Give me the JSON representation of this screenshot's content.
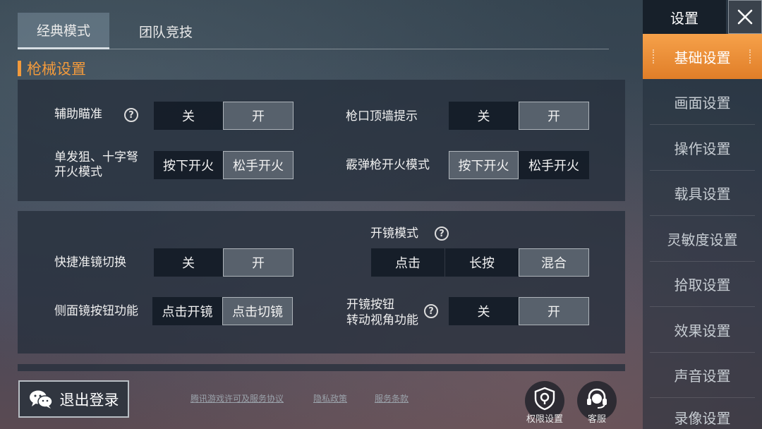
{
  "tabs": [
    {
      "label": "经典模式",
      "active": true
    },
    {
      "label": "团队竞技",
      "active": false
    }
  ],
  "section_title": "枪械设置",
  "panel1": {
    "rows": [
      {
        "label": "辅助瞄准",
        "options": [
          "关",
          "开"
        ],
        "selected": 1,
        "help": true
      },
      {
        "label": "枪口顶墙提示",
        "options": [
          "关",
          "开"
        ],
        "selected": 1
      },
      {
        "label_line1": "单发狙、十字弩",
        "label_line2": "开火模式",
        "options": [
          "按下开火",
          "松手开火"
        ],
        "selected": 1
      },
      {
        "label": "霰弹枪开火模式",
        "options": [
          "按下开火",
          "松手开火"
        ],
        "selected": 0
      }
    ]
  },
  "panel2": {
    "scope_mode": {
      "label": "开镜模式",
      "options": [
        "点击",
        "长按",
        "混合"
      ],
      "selected": 2,
      "help": true
    },
    "quick_scope": {
      "label": "快捷准镜切换",
      "options": [
        "关",
        "开"
      ],
      "selected": 1
    },
    "side_scope": {
      "label": "侧面镜按钮功能",
      "options": [
        "点击开镜",
        "点击切镜"
      ],
      "selected": 1
    },
    "scope_rotate": {
      "label_line1": "开镜按钮",
      "label_line2": "转动视角功能",
      "options": [
        "关",
        "开"
      ],
      "selected": 1,
      "help": true
    }
  },
  "sidebar": {
    "title": "设置",
    "items": [
      {
        "label": "基础设置",
        "active": true
      },
      {
        "label": "画面设置"
      },
      {
        "label": "操作设置"
      },
      {
        "label": "载具设置"
      },
      {
        "label": "灵敏度设置"
      },
      {
        "label": "拾取设置"
      },
      {
        "label": "效果设置"
      },
      {
        "label": "声音设置"
      },
      {
        "label": "录像设置"
      }
    ]
  },
  "bottom": {
    "logout": "退出登录",
    "links": [
      "腾讯游戏许可及服务协议",
      "隐私政策",
      "服务条款"
    ],
    "permission": "权限设置",
    "service": "客服"
  },
  "colors": {
    "accent": "#f29a3c",
    "sidebar_active": "#ee8e36"
  },
  "icons": {
    "help": "question-circle-icon",
    "close": "close-icon",
    "wechat": "wechat-icon",
    "shield": "shield-pin-icon",
    "headset": "headset-icon"
  }
}
